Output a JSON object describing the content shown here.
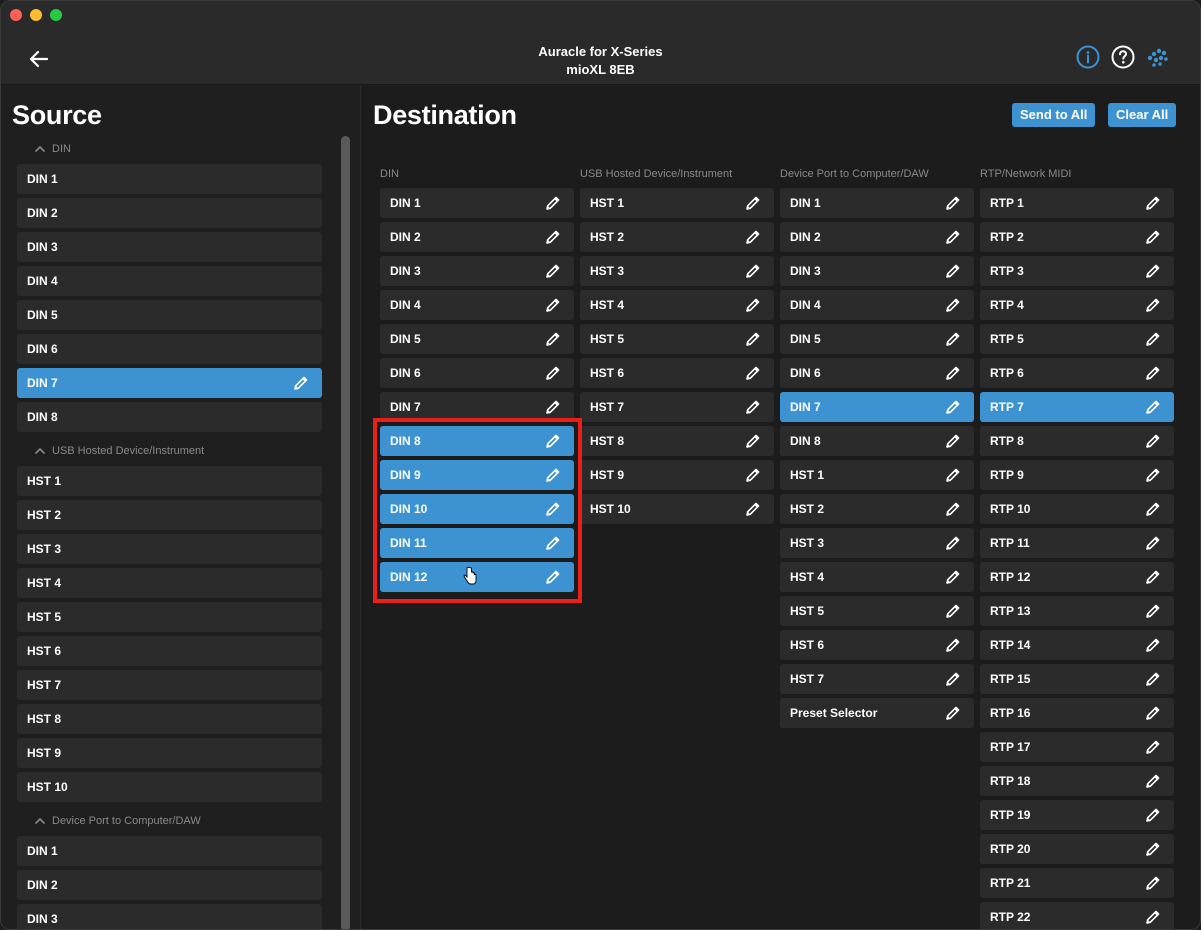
{
  "window": {
    "title_line1": "Auracle for X-Series",
    "title_line2": "mioXL 8EB"
  },
  "header": {
    "back_icon": "back-arrow-icon",
    "info_icon": "info-icon",
    "help_icon": "help-icon",
    "brand_icon": "brand-logo-icon"
  },
  "source": {
    "title": "Source",
    "groups": [
      {
        "label": "DIN",
        "items": [
          "DIN 1",
          "DIN 2",
          "DIN 3",
          "DIN 4",
          "DIN 5",
          "DIN 6",
          "DIN 7",
          "DIN 8"
        ],
        "selected": "DIN 7"
      },
      {
        "label": "USB Hosted Device/Instrument",
        "items": [
          "HST 1",
          "HST 2",
          "HST 3",
          "HST 4",
          "HST 5",
          "HST 6",
          "HST 7",
          "HST 8",
          "HST 9",
          "HST 10"
        ]
      },
      {
        "label": "Device Port to Computer/DAW",
        "items": [
          "DIN 1",
          "DIN 2",
          "DIN 3"
        ]
      }
    ]
  },
  "destination": {
    "title": "Destination",
    "send_all_label": "Send to All",
    "clear_all_label": "Clear All",
    "columns": [
      {
        "header": "DIN",
        "items": [
          "DIN 1",
          "DIN 2",
          "DIN 3",
          "DIN 4",
          "DIN 5",
          "DIN 6",
          "DIN 7",
          "DIN 8",
          "DIN 9",
          "DIN 10",
          "DIN 11",
          "DIN 12"
        ],
        "selected": [
          "DIN 8",
          "DIN 9",
          "DIN 10",
          "DIN 11",
          "DIN 12"
        ]
      },
      {
        "header": "USB Hosted Device/Instrument",
        "items": [
          "HST 1",
          "HST 2",
          "HST 3",
          "HST 4",
          "HST 5",
          "HST 6",
          "HST 7",
          "HST 8",
          "HST 9",
          "HST 10"
        ],
        "selected": []
      },
      {
        "header": "Device Port to Computer/DAW",
        "items": [
          "DIN 1",
          "DIN 2",
          "DIN 3",
          "DIN 4",
          "DIN 5",
          "DIN 6",
          "DIN 7",
          "DIN 8",
          "HST 1",
          "HST 2",
          "HST 3",
          "HST 4",
          "HST 5",
          "HST 6",
          "HST 7",
          "Preset Selector"
        ],
        "selected": [
          "DIN 7"
        ]
      },
      {
        "header": "RTP/Network MIDI",
        "items": [
          "RTP 1",
          "RTP 2",
          "RTP 3",
          "RTP 4",
          "RTP 5",
          "RTP 6",
          "RTP 7",
          "RTP 8",
          "RTP 9",
          "RTP 10",
          "RTP 11",
          "RTP 12",
          "RTP 13",
          "RTP 14",
          "RTP 15",
          "RTP 16",
          "RTP 17",
          "RTP 18",
          "RTP 19",
          "RTP 20",
          "RTP 21",
          "RTP 22"
        ],
        "selected": [
          "RTP 7"
        ]
      }
    ]
  },
  "colors": {
    "accent": "#3d93d2",
    "highlight": "#e8201a",
    "row_bg": "#2b2b2b",
    "panel_bg": "#1f1f1f"
  }
}
